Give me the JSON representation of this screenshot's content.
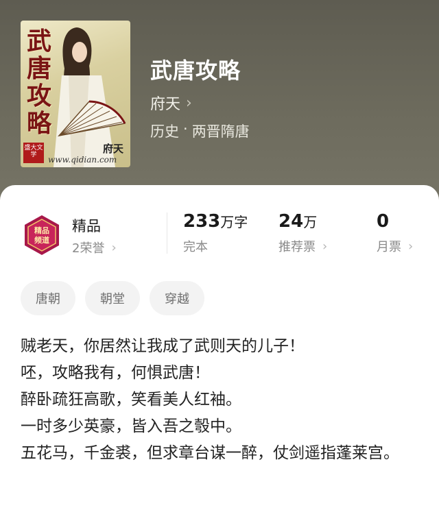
{
  "book": {
    "title": "武唐攻略",
    "author": "府天",
    "author_chevron": "›",
    "genre": "历史",
    "genre_sep": "·",
    "subgenre": "两晋隋唐"
  },
  "cover": {
    "title_chars": "武唐攻略",
    "badge_text": "盛大文学",
    "author_sig": "府天",
    "site": "www.qidian.com"
  },
  "quality": {
    "name": "精品",
    "honor": "2荣誉",
    "emblem_text": "精品频道",
    "chevron": "›"
  },
  "stats": [
    {
      "number": "233",
      "unit": "万字",
      "label": "完本",
      "chevron": ""
    },
    {
      "number": "24",
      "unit": "万",
      "label": "推荐票",
      "chevron": "›"
    },
    {
      "number": "0",
      "unit": "",
      "label": "月票",
      "chevron": "›"
    }
  ],
  "tags": [
    "唐朝",
    "朝堂",
    "穿越"
  ],
  "intro": [
    "贼老天，你居然让我成了武则天的儿子！",
    "呸，攻略我有，何惧武唐！",
    "醉卧疏狂高歌，笑看美人红袖。",
    "一时多少英豪，皆入吾之彀中。",
    "五花马，千金裘，但求章台谋一醉，仗剑遥指蓬莱宫。"
  ]
}
